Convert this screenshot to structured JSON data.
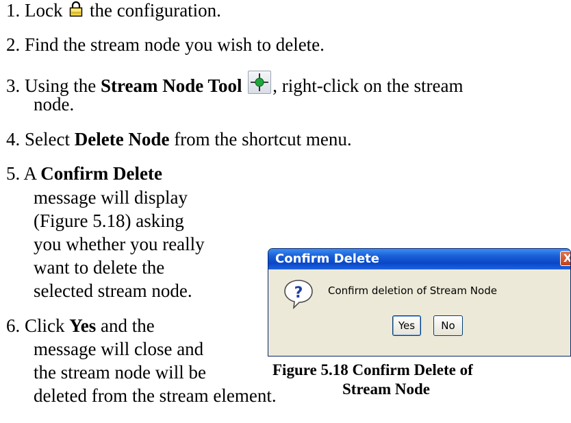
{
  "steps": [
    {
      "num": "1.",
      "before": "Lock",
      "after": "the configuration."
    },
    {
      "num": "2.",
      "text": "Find the stream node you wish to delete."
    },
    {
      "num": "3.",
      "before": "Using the ",
      "bold": "Stream Node Tool",
      "after": ", right-click on the stream",
      "cont": "node."
    },
    {
      "num": "4.",
      "before": "Select ",
      "bold": "Delete Node",
      "after": " from the shortcut menu."
    },
    {
      "num": "5.",
      "before": "A ",
      "bold": "Confirm Delete",
      "lines": [
        "message will display",
        "(Figure 5.18) asking",
        "you whether you really",
        "want to delete the",
        "selected stream node."
      ]
    },
    {
      "num": "6.",
      "before": "Click ",
      "bold": "Yes",
      "after": " and the",
      "lines": [
        "message will close and",
        "the stream node will be",
        "deleted from the stream element."
      ]
    }
  ],
  "dialog": {
    "title": "Confirm Delete",
    "close": "X",
    "message": "Confirm deletion of Stream Node",
    "yes_label": "Yes",
    "no_label": "No"
  },
  "caption": {
    "line1": "Figure 5.18  Confirm Delete of",
    "line2": "Stream Node"
  },
  "icons": {
    "lock": "lock-icon",
    "tool": "crosshair-icon",
    "dialog": "question-icon"
  }
}
